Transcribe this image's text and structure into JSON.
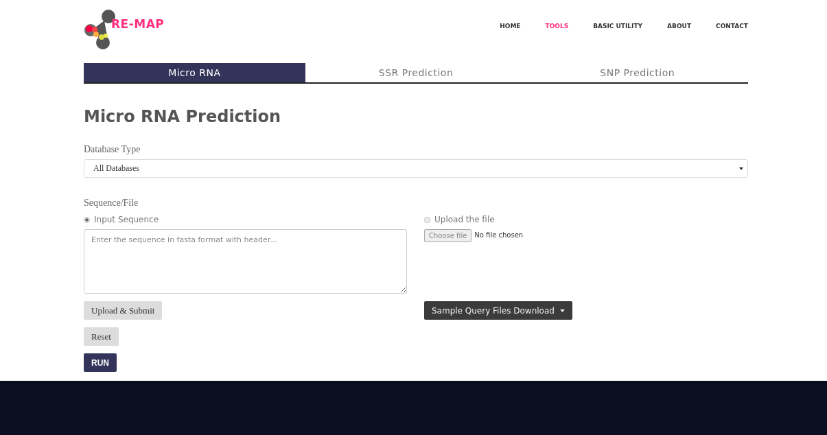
{
  "logo": {
    "text": "RE-MAP"
  },
  "nav": [
    {
      "label": "HOME",
      "selected": false
    },
    {
      "label": "TOOLS",
      "selected": true
    },
    {
      "label": "BASIC UTILITY",
      "selected": false
    },
    {
      "label": "ABOUT",
      "selected": false
    },
    {
      "label": "CONTACT",
      "selected": false
    }
  ],
  "tabs": [
    {
      "label": "Micro RNA",
      "selected": true
    },
    {
      "label": "SSR Prediction",
      "selected": false
    },
    {
      "label": "SNP Prediction",
      "selected": false
    }
  ],
  "heading": "Micro RNA Prediction",
  "database": {
    "label": "Database Type",
    "value": "All Databases"
  },
  "sequence": {
    "label": "Sequence/File",
    "options": [
      {
        "label": "Input Sequence",
        "selected": true
      },
      {
        "label": "Upload the file",
        "selected": false
      }
    ],
    "textarea": {
      "placeholder": "Enter the sequence in fasta format with header..."
    },
    "file": {
      "button": "Choose file",
      "status": "No file chosen"
    }
  },
  "buttons": {
    "upload": "Upload & Submit",
    "sample": "Sample Query Files Download",
    "reset": "Reset",
    "run": "RUN"
  }
}
